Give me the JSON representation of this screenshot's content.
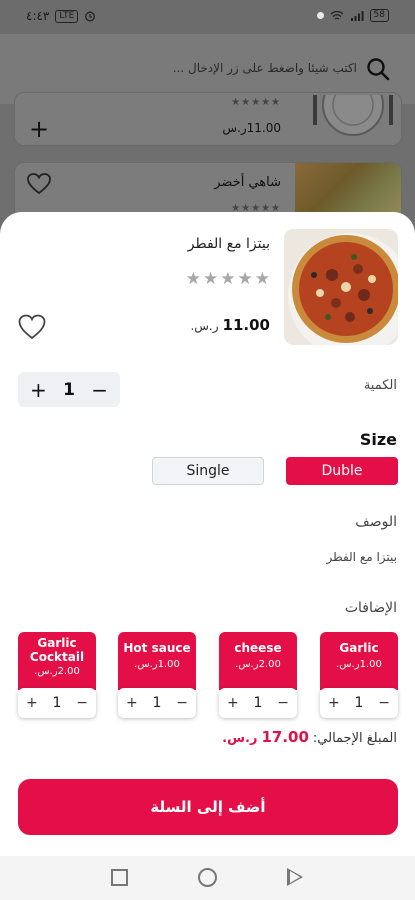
{
  "status_bar": {
    "time": "٤:٤٣",
    "left_badge": "LTE",
    "battery": "58"
  },
  "search": {
    "placeholder": "اكتب شيئا واضغط على زر الإدخال ..."
  },
  "background_list": [
    {
      "stars": "★★★★★",
      "price": "11.00ر.س"
    },
    {
      "title": "شاهي أخضر",
      "stars": "★★★★★"
    }
  ],
  "product": {
    "title": "بيتزا مع الفطر",
    "rating_of_5": 0,
    "stars": [
      "★",
      "★",
      "★",
      "★",
      "★"
    ],
    "price": "11.00",
    "currency": "ر.س."
  },
  "quantity": {
    "label": "الكمية",
    "value": "1",
    "plus": "+",
    "minus": "−"
  },
  "size": {
    "title": "Size",
    "options": [
      {
        "label": "Duble",
        "selected": true
      },
      {
        "label": "Single",
        "selected": false
      }
    ]
  },
  "description": {
    "title": "الوصف",
    "text": "بيتزا مع الفطر"
  },
  "addons": {
    "title": "الإضافات",
    "items": [
      {
        "name": "Garlic",
        "price": "1.00ر.س.",
        "qty": "1"
      },
      {
        "name": "cheese",
        "price": "2.00ر.س.",
        "qty": "1"
      },
      {
        "name": "Hot sauce",
        "price": "1.00ر.س.",
        "qty": "1"
      },
      {
        "name": "Garlic Cocktail",
        "price": "2.00ر.س.",
        "qty": "1"
      }
    ]
  },
  "total": {
    "label": "المبلغ الإجمالي:",
    "amount": "17.00",
    "currency": "ر.س."
  },
  "add_to_cart": {
    "label": "أضف إلى السلة"
  },
  "colors": {
    "accent": "#e40f47",
    "overlay": "#6f6f6f",
    "sheet": "#ffffff"
  },
  "icons": [
    "search-icon",
    "heart-icon",
    "plus-icon",
    "minus-icon",
    "pizza-image",
    "nav-square-icon",
    "nav-circle-icon",
    "nav-back-icon"
  ]
}
